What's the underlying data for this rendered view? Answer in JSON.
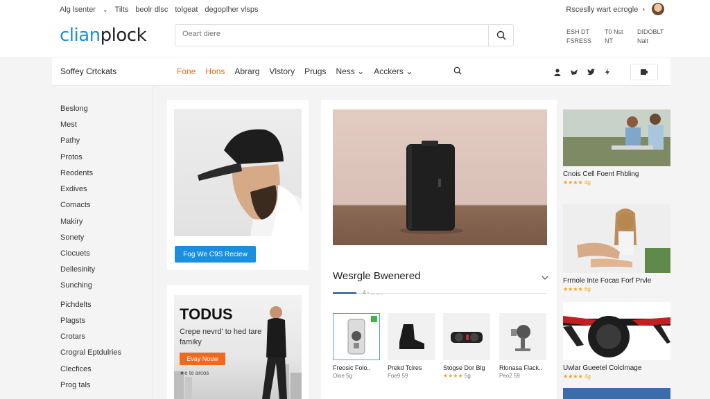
{
  "topbar": {
    "links": [
      "Alg lsenter",
      "Tilts",
      "beolr dlsc",
      "tolgeat",
      "degoplher vlsps"
    ],
    "right_text": "Rsceslly wart ecrogle"
  },
  "header": {
    "logo_part1": "clian",
    "logo_part2": "plock",
    "search_placeholder": "Oeart diere",
    "acct1": [
      "ESH DT",
      "FSRESS"
    ],
    "acct2": [
      "T0 Nst",
      "NT"
    ],
    "acct3": [
      "DIDOBLT",
      "Nalt"
    ]
  },
  "nav": {
    "category_label": "Soffey Crtckats",
    "links": [
      "Fone",
      "Hons",
      "Abrarg",
      "Vlstory",
      "Prugs",
      "Ness",
      "Acckers"
    ],
    "active_indices": [
      0,
      1
    ]
  },
  "sidebar": {
    "items": [
      "Beslong",
      "Mest",
      "Pathy",
      "Protos",
      "Reodents",
      "Exdives",
      "Comacts",
      "Makiry",
      "Sonety",
      "Clocuets",
      "Dellesinity",
      "Sunching",
      "Pichdelts",
      "Plagsts",
      "Crotars",
      "Crogral Eptdulries",
      "Clecfices",
      "Prog tals"
    ]
  },
  "promo1": {
    "cta_label": "Fog We C9S Reciew"
  },
  "promo2": {
    "headline": "TODUS",
    "text": "Crepe nevrd' to hed tare famiky",
    "shop_label": "Evay Nouw",
    "small_text": "★e te arcos"
  },
  "main": {
    "section_title": "Wesrgle Bwenered",
    "sub_label": "4  -  ........",
    "products": [
      {
        "name": "Freosic Folo..",
        "price": "Oloe 5g",
        "stars": ""
      },
      {
        "name": "Prekd Tclres",
        "price": "Foe9 59",
        "stars": ""
      },
      {
        "name": "Stogse Dor Blg",
        "price": "5g",
        "stars": "★★★★"
      },
      {
        "name": "Rlonasa Flack..",
        "price": "Peo2 59",
        "stars": ""
      }
    ]
  },
  "right": {
    "items": [
      {
        "name": "Cnois Cell Foent Fhbling",
        "rating": "★★★★ 4g"
      },
      {
        "name": "Frrnole Inte Focas Forf Prvle",
        "rating": "★★★★ 6g"
      },
      {
        "name": "Uwlar Gueetel Colclmage",
        "rating": "★★★★ 4g"
      }
    ]
  },
  "colors": {
    "accent_blue": "#1a8fe0",
    "accent_orange": "#f06a1d"
  }
}
